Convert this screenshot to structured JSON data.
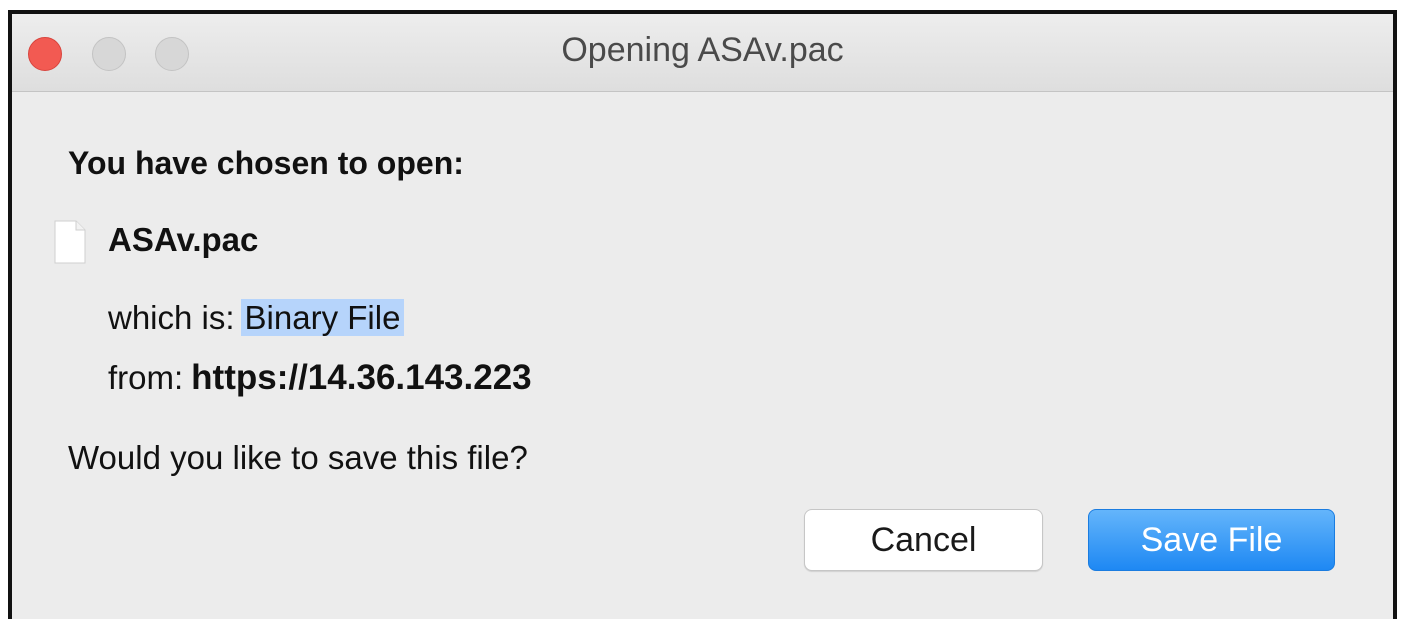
{
  "window": {
    "title": "Opening ASAv.pac",
    "controls": {
      "close_color": "#f25a52",
      "minimize_color": "#d7d7d7",
      "zoom_color": "#d7d7d7"
    }
  },
  "dialog": {
    "heading": "You have chosen to open:",
    "file": {
      "icon": "document-icon",
      "name": "ASAv.pac",
      "type_label": "which is:",
      "type_value": "Binary File",
      "from_label": "from:",
      "from_value": "https://14.36.143.223"
    },
    "question": "Would you like to save this file?"
  },
  "buttons": {
    "cancel_label": "Cancel",
    "save_label": "Save File",
    "accent_color": "#1e88f3"
  }
}
